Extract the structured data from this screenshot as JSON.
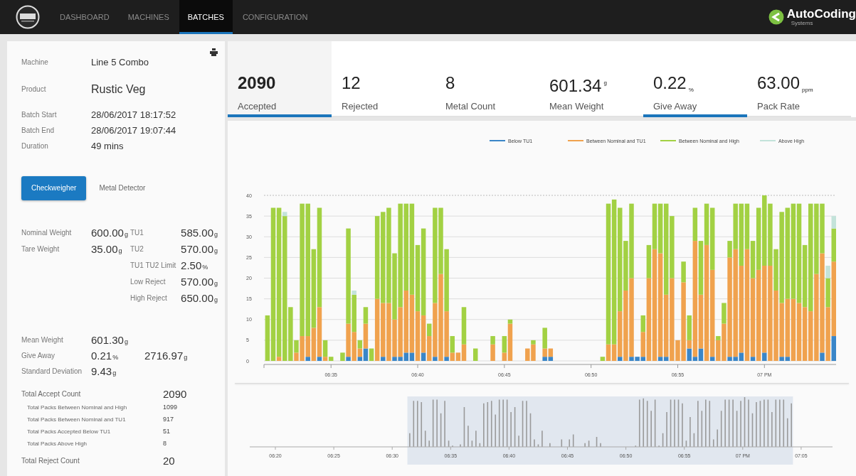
{
  "nav": {
    "items": [
      {
        "label": "DASHBOARD",
        "selected": false
      },
      {
        "label": "MACHINES",
        "selected": false
      },
      {
        "label": "BATCHES",
        "selected": true
      },
      {
        "label": "CONFIGURATION",
        "selected": false
      }
    ],
    "brand": {
      "name": "AutoCoding",
      "subtitle": "Systems"
    }
  },
  "batch_info": [
    {
      "label": "Machine",
      "value": "Line 5 Combo"
    },
    {
      "label": "Product",
      "value": "Rustic Veg"
    },
    {
      "label": "Batch Start",
      "value": "28/06/2017 18:17:52"
    },
    {
      "label": "Batch End",
      "value": "28/06/2017 19:07:44"
    },
    {
      "label": "Duration",
      "value": "49 mins"
    }
  ],
  "device_tabs": [
    {
      "label": "Checkweigher",
      "selected": true
    },
    {
      "label": "Metal Detector",
      "selected": false
    }
  ],
  "settings": {
    "left": [
      {
        "label": "Nominal Weight",
        "value": "600.00",
        "unit": "g"
      },
      {
        "label": "Tare Weight",
        "value": "35.00",
        "unit": "g"
      }
    ],
    "right": [
      {
        "label": "TU1",
        "value": "585.00",
        "unit": "g"
      },
      {
        "label": "TU2",
        "value": "570.00",
        "unit": "g"
      },
      {
        "label": "TU1 TU2 Limit",
        "value": "2.50",
        "unit": "%"
      },
      {
        "label": "Low Reject",
        "value": "570.00",
        "unit": "g"
      },
      {
        "label": "High Reject",
        "value": "650.00",
        "unit": "g"
      }
    ]
  },
  "statistics": [
    {
      "label": "Mean Weight",
      "values": [
        {
          "value": "601.30",
          "unit": "g"
        }
      ]
    },
    {
      "label": "Give Away",
      "values": [
        {
          "value": "0.21",
          "unit": "%"
        },
        {
          "value": "2716.97",
          "unit": "g"
        }
      ]
    },
    {
      "label": "Standard Deviation",
      "values": [
        {
          "value": "9.43",
          "unit": "g"
        }
      ]
    }
  ],
  "counts": [
    {
      "label": "Total Accept Count",
      "value": "2090",
      "children": [
        {
          "label": "Total Packs Between Nominal and High",
          "value": "1099"
        },
        {
          "label": "Total Packs Between Nominal and TU1",
          "value": "917"
        },
        {
          "label": "Total Packs Accepted Below TU1",
          "value": "51"
        },
        {
          "label": "Total Packs Above High",
          "value": "8"
        }
      ]
    },
    {
      "label": "Total Reject Count",
      "value": "20"
    }
  ],
  "summary_tabs": [
    {
      "value": "2090",
      "label": "Accepted",
      "selected": true,
      "underlined": true
    },
    {
      "value": "12",
      "label": "Rejected",
      "selected": false,
      "underlined": false
    },
    {
      "value": "8",
      "label": "Metal Count",
      "selected": false,
      "underlined": false
    },
    {
      "value": "601.34$^{g}$",
      "label": "Mean Weight",
      "selected": false,
      "underlined": false
    },
    {
      "value": "0.22$_{%}$",
      "label": "Give Away",
      "selected": false,
      "underlined": true
    },
    {
      "value": "63.00$_{ppm}$",
      "label": "Pack Rate",
      "selected": false,
      "underlined": false
    }
  ],
  "chart": {
    "chart_data": {
      "type": "bar",
      "stacked": true,
      "categories": [
        null,
        null,
        null,
        null,
        null,
        null,
        null,
        null,
        null,
        null,
        null,
        "06:35",
        null,
        null,
        null,
        null,
        null,
        null,
        null,
        null,
        null,
        null,
        null,
        null,
        null,
        null,
        "06:40",
        null,
        null,
        null,
        null,
        null,
        null,
        null,
        null,
        null,
        null,
        null,
        null,
        null,
        null,
        "06:45",
        null,
        null,
        null,
        null,
        null,
        null,
        null,
        null,
        null,
        null,
        null,
        null,
        null,
        null,
        "06:50",
        null,
        null,
        null,
        null,
        null,
        null,
        null,
        null,
        null,
        null,
        null,
        null,
        null,
        null,
        "06:55",
        null,
        null,
        null,
        null,
        null,
        null,
        null,
        null,
        null,
        null,
        null,
        null,
        null,
        null,
        "07 PM",
        null,
        null,
        null,
        null,
        null,
        null,
        null,
        null,
        null,
        null,
        null,
        null
      ],
      "series": [
        {
          "name": "Below TU1",
          "color": "#3a86c8",
          "values": [
            0,
            0,
            0,
            0,
            0,
            0,
            0,
            1,
            0,
            1,
            0,
            0,
            null,
            0,
            1,
            0,
            1,
            3,
            0,
            0,
            1,
            0,
            1,
            1,
            2,
            2,
            0,
            2,
            0,
            1,
            0,
            1,
            0,
            0,
            0,
            null,
            0,
            null,
            null,
            0,
            null,
            0,
            0,
            null,
            null,
            0,
            0,
            null,
            1,
            1,
            null,
            null,
            null,
            null,
            null,
            null,
            null,
            null,
            0,
            0,
            0,
            1,
            0,
            1,
            1,
            1,
            0,
            0,
            1,
            1,
            0,
            0,
            0,
            3,
            1,
            3,
            0,
            1,
            0,
            0,
            1,
            1,
            2,
            0,
            1,
            0,
            2,
            0,
            0,
            1,
            1,
            0,
            0,
            0,
            0,
            0,
            2,
            0,
            6
          ]
        },
        {
          "name": "Between Nominal and TU1",
          "color": "#f0a24e",
          "values": [
            0,
            0,
            1,
            0,
            0,
            2,
            6,
            5,
            8,
            12,
            1,
            0,
            null,
            0,
            8,
            7,
            2,
            6,
            0,
            15,
            13,
            14,
            9,
            12,
            15,
            14,
            12,
            9,
            6,
            13,
            21,
            11,
            2,
            2,
            4,
            null,
            0,
            null,
            null,
            4,
            null,
            2,
            9,
            null,
            null,
            3,
            4,
            null,
            2,
            2,
            null,
            null,
            null,
            null,
            null,
            null,
            null,
            null,
            0,
            4,
            4,
            11,
            17,
            19,
            0,
            6,
            20,
            27,
            25,
            15,
            20,
            5,
            19,
            2,
            28,
            13,
            28,
            21,
            5,
            9,
            24,
            26,
            21,
            27,
            19,
            22,
            21,
            23,
            17,
            13,
            14,
            15,
            14,
            13,
            12,
            21,
            24,
            13,
            18
          ]
        },
        {
          "name": "Between Nominal and High",
          "color": "#a2d143",
          "values": [
            11,
            37,
            36,
            35,
            13,
            3,
            32,
            32,
            19,
            24,
            4,
            1,
            null,
            2,
            23,
            9,
            2,
            4,
            3,
            20,
            22,
            23,
            16,
            25,
            21,
            22,
            16,
            21,
            3,
            23,
            16,
            15,
            4,
            0,
            9,
            null,
            3,
            null,
            null,
            2,
            null,
            4,
            1,
            null,
            null,
            0,
            1,
            null,
            5,
            0,
            null,
            null,
            null,
            null,
            null,
            null,
            null,
            null,
            1,
            34,
            35,
            25,
            12,
            18,
            0,
            4,
            8,
            11,
            12,
            22,
            15,
            0,
            5,
            6,
            8,
            13,
            10,
            15,
            1,
            5,
            4,
            11,
            15,
            11,
            9,
            15,
            17,
            15,
            10,
            22,
            22,
            23,
            24,
            15,
            26,
            17,
            12,
            7,
            8
          ]
        },
        {
          "name": "Above High",
          "color": "#c3e3da",
          "values": [
            0,
            0,
            0,
            1,
            0,
            0,
            0,
            0,
            0,
            0,
            0,
            0,
            null,
            0,
            0,
            1,
            0,
            0,
            0,
            0,
            0,
            0,
            0,
            0,
            0,
            0,
            0,
            0,
            0,
            0,
            0,
            0,
            0,
            0,
            0,
            null,
            0,
            null,
            null,
            0,
            null,
            0,
            0,
            null,
            null,
            0,
            0,
            null,
            0,
            0,
            null,
            null,
            null,
            null,
            null,
            null,
            null,
            null,
            0,
            0,
            0,
            0,
            0,
            0,
            0,
            0,
            0,
            0,
            0,
            0,
            0,
            0,
            0,
            0,
            0,
            0,
            0,
            0,
            0,
            0,
            0,
            0,
            0,
            0,
            0,
            0,
            0,
            0,
            0,
            0,
            0,
            0,
            0,
            0,
            0,
            0,
            0,
            3,
            3
          ]
        }
      ],
      "legend": "top",
      "grid": true,
      "ylim": [
        0,
        40
      ],
      "yticks": [
        0,
        5,
        10,
        15,
        20,
        25,
        30,
        35,
        40
      ]
    },
    "overview": {
      "tick_labels": [
        "06:20",
        "06:25",
        "06:30",
        "06:35",
        "06:40",
        "06:45",
        "06:50",
        "06:55",
        "07 PM",
        "07:05"
      ]
    }
  }
}
